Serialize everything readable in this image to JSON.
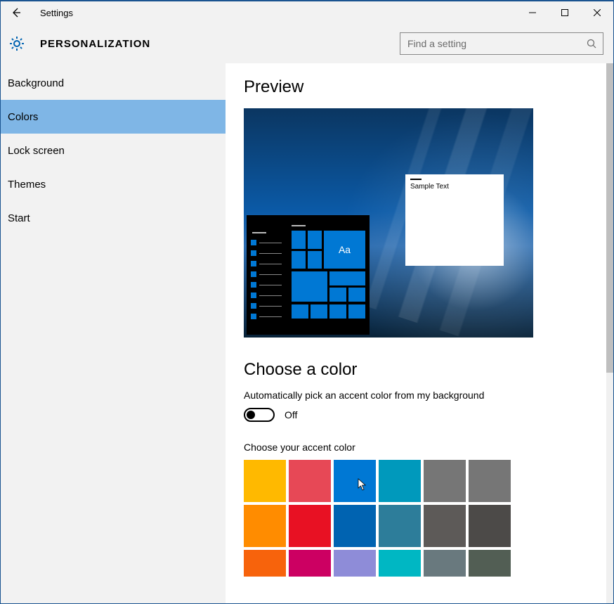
{
  "window": {
    "title": "Settings"
  },
  "header": {
    "title": "PERSONALIZATION",
    "search_placeholder": "Find a setting"
  },
  "sidebar": {
    "items": [
      {
        "label": "Background",
        "selected": false
      },
      {
        "label": "Colors",
        "selected": true
      },
      {
        "label": "Lock screen",
        "selected": false
      },
      {
        "label": "Themes",
        "selected": false
      },
      {
        "label": "Start",
        "selected": false
      }
    ]
  },
  "content": {
    "preview_title": "Preview",
    "preview_sample_text": "Sample Text",
    "preview_tile_label": "Aa",
    "choose_color_title": "Choose a color",
    "auto_pick_label": "Automatically pick an accent color from my background",
    "toggle_state": "Off",
    "choose_accent_label": "Choose your accent color",
    "accent_colors": [
      [
        "#ffb900",
        "#e74856",
        "#0078d4",
        "#0099bc",
        "#767676",
        "#767676"
      ],
      [
        "#ff8c00",
        "#e81123",
        "#0063b1",
        "#2d7d9a",
        "#5d5a58",
        "#4c4a48"
      ],
      [
        "#f7630c",
        "#cc0062",
        "#8e8cd8",
        "#00b7c3",
        "#69797e",
        "#525e54"
      ]
    ],
    "selected_swatch_row": 0,
    "selected_swatch_col": 2
  }
}
